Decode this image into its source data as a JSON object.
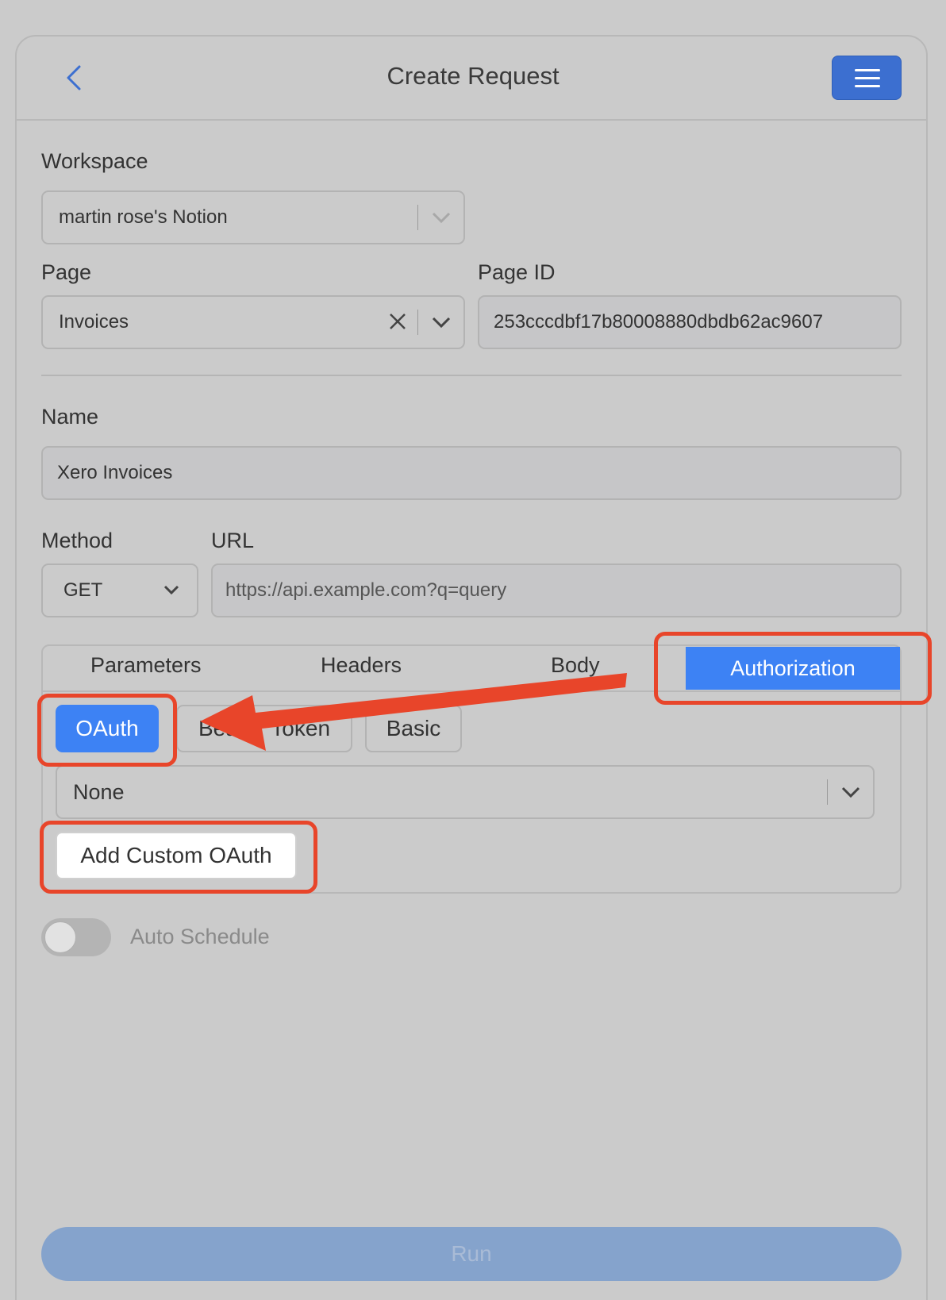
{
  "header": {
    "title": "Create Request",
    "back_icon": "chevron-left-icon",
    "menu_icon": "hamburger-icon"
  },
  "workspace": {
    "label": "Workspace",
    "value": "martin rose's Notion"
  },
  "page": {
    "label": "Page",
    "value": "Invoices",
    "clear_icon": "close-icon"
  },
  "page_id": {
    "label": "Page ID",
    "value": "253cccdbf17b80008880dbdb62ac9607"
  },
  "name": {
    "label": "Name",
    "value": "Xero Invoices"
  },
  "method": {
    "label": "Method",
    "value": "GET"
  },
  "url": {
    "label": "URL",
    "placeholder": "https://api.example.com?q=query"
  },
  "tabs": [
    {
      "label": "Parameters"
    },
    {
      "label": "Headers"
    },
    {
      "label": "Body"
    },
    {
      "label": "Authorization",
      "active": true
    }
  ],
  "auth": {
    "types": [
      {
        "label": "OAuth",
        "active": true
      },
      {
        "label": "Bearer Token"
      },
      {
        "label": "Basic"
      }
    ],
    "select_value": "None",
    "add_custom_label": "Add Custom OAuth"
  },
  "auto_schedule": {
    "label": "Auto Schedule",
    "enabled": false
  },
  "run": {
    "label": "Run"
  },
  "colors": {
    "accent": "#3d82f4",
    "highlight": "#e8452a",
    "run": "#85a3cc"
  }
}
